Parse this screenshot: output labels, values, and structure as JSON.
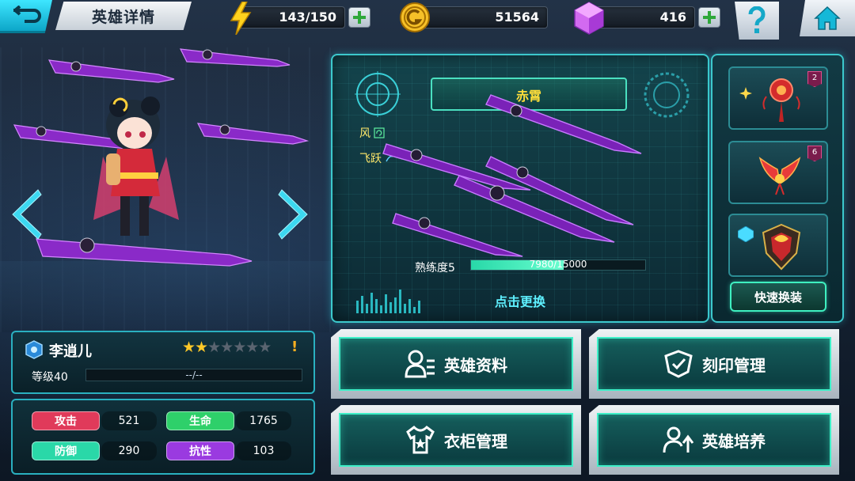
{
  "header": {
    "title": "英雄详情",
    "back_icon": "back-icon",
    "help_icon": "help-icon",
    "home_icon": "home-icon"
  },
  "resources": {
    "energy": {
      "icon": "lightning-icon",
      "value": "143/150"
    },
    "gold": {
      "icon": "gold-coin-icon",
      "value": "51564"
    },
    "gems": {
      "icon": "gem-icon",
      "value": "416"
    }
  },
  "weapon": {
    "name": "赤霄",
    "attributes": [
      {
        "label": "风",
        "icon": "wind-icon"
      },
      {
        "label": "飞跃",
        "icon": "leap-icon"
      }
    ],
    "proficiency_label": "熟练度5",
    "proficiency_text": "7980/15000",
    "proficiency_value": 7980,
    "proficiency_max": 15000,
    "change_label": "点击更换"
  },
  "accessories": {
    "slots": [
      {
        "icon": "red-orb-ornament-icon",
        "badge": "2"
      },
      {
        "icon": "phoenix-wings-icon",
        "badge": "6"
      },
      {
        "icon": "emblem-crest-icon",
        "badge": ""
      }
    ],
    "quick_swap_label": "快速换装"
  },
  "hero": {
    "name": "李逍儿",
    "stars_filled": 2,
    "stars_total": 7,
    "alert": "!",
    "level_label": "等级40",
    "exp_text": "--/--"
  },
  "stats": [
    {
      "label": "攻击",
      "value": "521",
      "color": "#e03a5a"
    },
    {
      "label": "生命",
      "value": "1765",
      "color": "#2ed06a"
    },
    {
      "label": "防御",
      "value": "290",
      "color": "#2ad8a8"
    },
    {
      "label": "抗性",
      "value": "103",
      "color": "#9a3ae0"
    }
  ],
  "menu": {
    "hero_info": {
      "label": "英雄资料",
      "icon": "hero-profile-icon"
    },
    "imprint": {
      "label": "刻印管理",
      "icon": "imprint-icon"
    },
    "wardrobe": {
      "label": "衣柜管理",
      "icon": "wardrobe-icon"
    },
    "training": {
      "label": "英雄培养",
      "icon": "training-icon"
    }
  }
}
